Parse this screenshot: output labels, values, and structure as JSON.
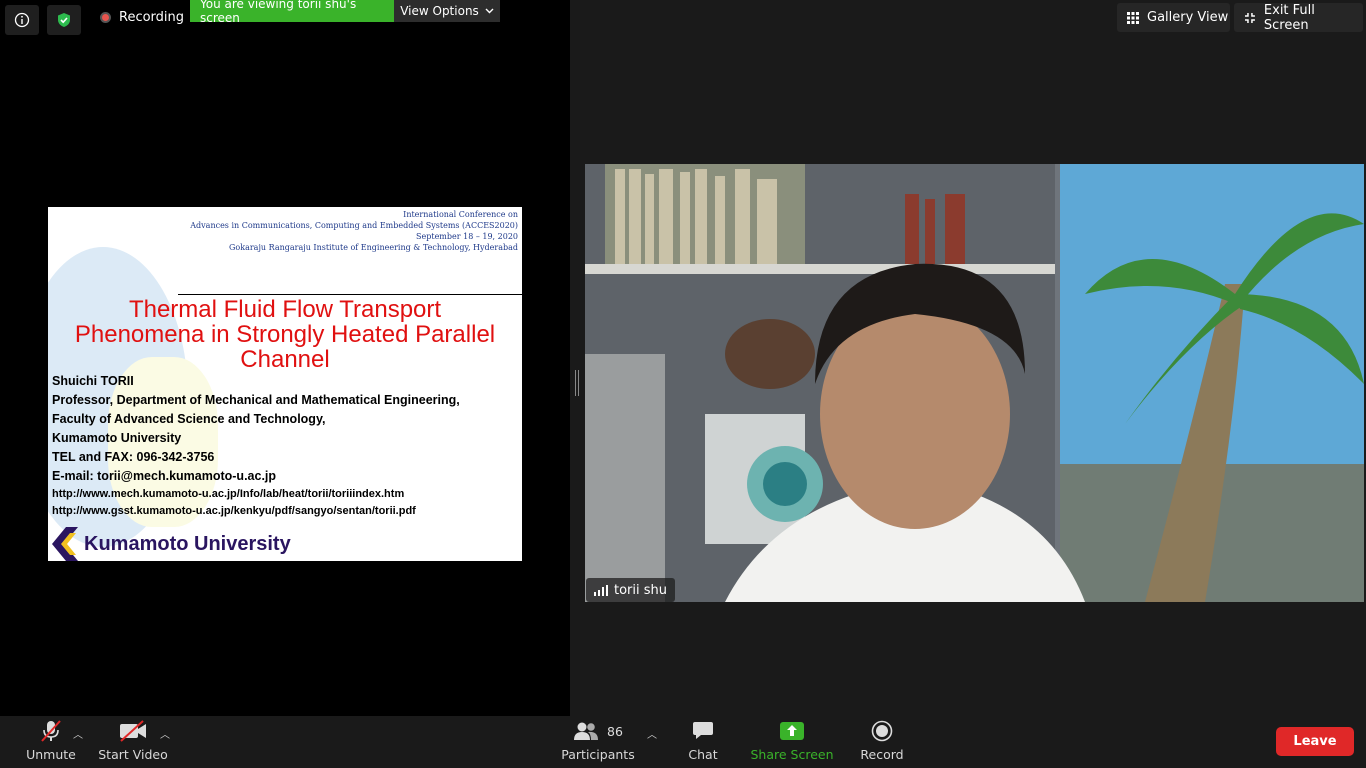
{
  "top_bar": {
    "recording_label": "Recording",
    "viewing_banner": "You are viewing torii shu's screen",
    "view_options_label": "View Options",
    "gallery_view_label": "Gallery View",
    "exit_full_screen_label": "Exit Full Screen"
  },
  "slide": {
    "conference_lines": [
      "International Conference on",
      "Advances in Communications, Computing and Embedded Systems (ACCES2020)",
      "September 18 – 19, 2020",
      "Gokaraju Rangaraju Institute of Engineering & Technology, Hyderabad"
    ],
    "title_lines": [
      "Thermal Fluid Flow Transport",
      "Phenomena in Strongly Heated Parallel",
      "Channel"
    ],
    "author": "Shuichi TORII",
    "position_lines": [
      "Professor, Department of Mechanical and Mathematical Engineering,",
      "Faculty of Advanced Science and Technology,",
      "Kumamoto University",
      "TEL and FAX: 096-342-3756",
      "E-mail: torii@mech.kumamoto-u.ac.jp"
    ],
    "urls": [
      "http://www.mech.kumamoto-u.ac.jp/Info/lab/heat/torii/toriiindex.htm",
      "http://www.gsst.kumamoto-u.ac.jp/kenkyu/pdf/sangyo/sentan/torii.pdf"
    ],
    "university_logo_text": "Kumamoto University"
  },
  "video": {
    "participant_name": "torii shu"
  },
  "toolbar": {
    "unmute_label": "Unmute",
    "start_video_label": "Start Video",
    "participants_label": "Participants",
    "participants_count": "86",
    "chat_label": "Chat",
    "share_screen_label": "Share Screen",
    "record_label": "Record",
    "leave_label": "Leave"
  },
  "colors": {
    "share_green": "#3ab32a",
    "leave_red": "#e02828",
    "slide_title_red": "#e01010"
  }
}
